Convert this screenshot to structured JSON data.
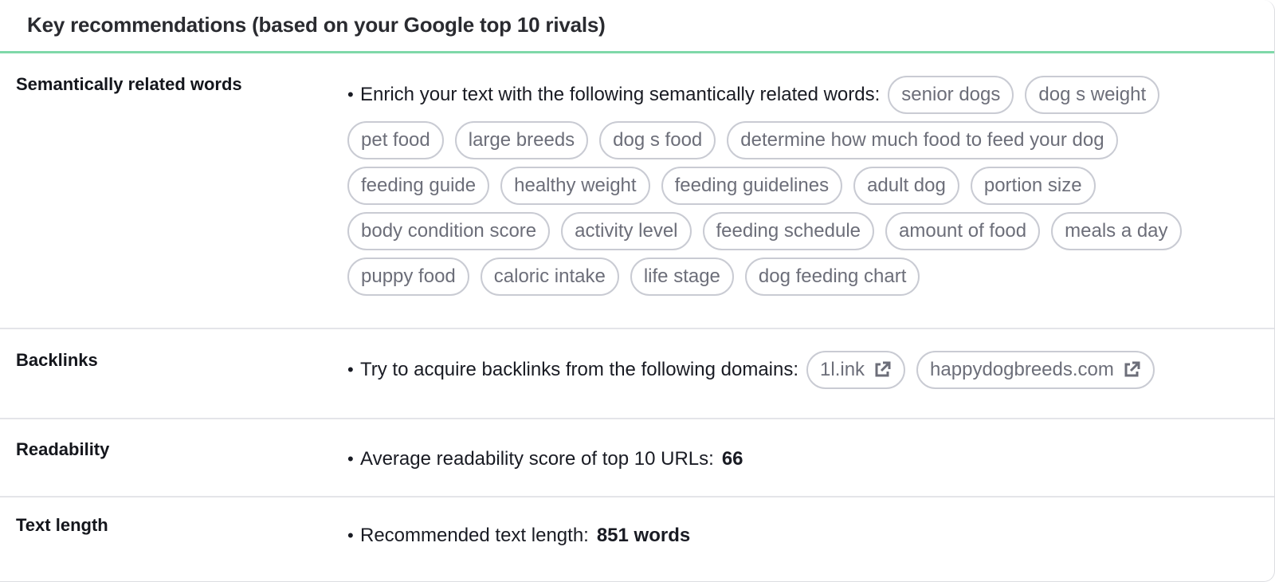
{
  "header": {
    "title": "Key recommendations (based on your Google top 10 rivals)"
  },
  "sections": {
    "semantic": {
      "label": "Semantically related words",
      "intro": "Enrich your text with the following semantically related words:",
      "words": [
        "senior dogs",
        "dog s weight",
        "pet food",
        "large breeds",
        "dog s food",
        "determine how much food to feed your dog",
        "feeding guide",
        "healthy weight",
        "feeding guidelines",
        "adult dog",
        "portion size",
        "body condition score",
        "activity level",
        "feeding schedule",
        "amount of food",
        "meals a day",
        "puppy food",
        "caloric intake",
        "life stage",
        "dog feeding chart"
      ]
    },
    "backlinks": {
      "label": "Backlinks",
      "intro": "Try to acquire backlinks from the following domains:",
      "domains": [
        "1l.ink",
        "happydogbreeds.com"
      ],
      "domain_icon": "external-link-icon"
    },
    "readability": {
      "label": "Readability",
      "text": "Average readability score of top 10 URLs:",
      "value": "66"
    },
    "text_length": {
      "label": "Text length",
      "text": "Recommended text length:",
      "value": "851 words"
    }
  },
  "colors": {
    "accent_line": "#7fd8a9",
    "chip_border": "#c9cbd3",
    "chip_text": "#6c6e79"
  }
}
